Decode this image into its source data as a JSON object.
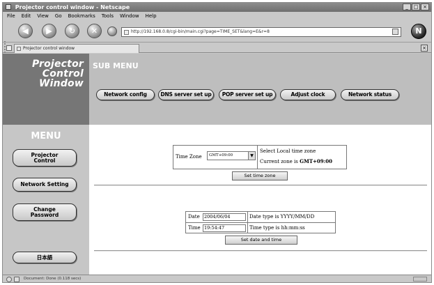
{
  "window": {
    "title": "Projector control window - Netscape",
    "min_label": "_",
    "max_label": "□",
    "close_label": "×"
  },
  "menubar": {
    "items": [
      "File",
      "Edit",
      "View",
      "Go",
      "Bookmarks",
      "Tools",
      "Window",
      "Help"
    ]
  },
  "navbar": {
    "url": "http://192.168.0.8/cgi-bin/main.cgi?page=TIME_SET&lang=E&r=8"
  },
  "tab": {
    "label": "Projector control window"
  },
  "brand": {
    "line1": "Projector",
    "line2": "Control",
    "line3": "Window"
  },
  "submenu": {
    "title": "SUB MENU",
    "items": [
      "Network config",
      "DNS server set up",
      "POP server set up",
      "Adjust clock",
      "Network status"
    ]
  },
  "leftnav": {
    "title": "MENU",
    "projector_control": [
      "Projector",
      "Control"
    ],
    "network_setting": "Network Setting",
    "change_password": [
      "Change",
      "Password"
    ],
    "language": "日本語"
  },
  "timezone": {
    "label": "Time Zone",
    "selected": "GMT+09:00",
    "hint": "Select Local time zone",
    "current_prefix": "Current zone is ",
    "current_value": "GMT+09:00",
    "button": "Set time zone"
  },
  "datetime": {
    "date_label": "Date",
    "date_value": "2004/06/04",
    "date_hint": "Date type is YYYY/MM/DD",
    "time_label": "Time",
    "time_value": "19:54:47",
    "time_hint": "Time type is hh:mm:ss",
    "button": "Set date and time"
  },
  "status": {
    "text": "Document: Done (0.118 secs)"
  }
}
